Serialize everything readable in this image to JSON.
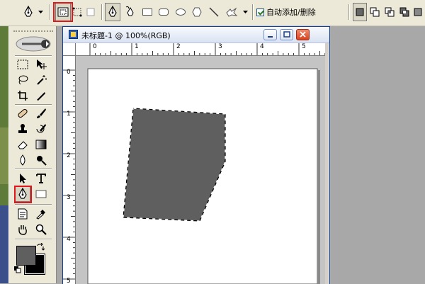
{
  "options_bar": {
    "auto_add_delete_label": "自动添加/删除",
    "auto_add_delete_checked": true,
    "icons": [
      "pen-tool-icon",
      "dropdown-arrow-icon",
      "shape-layers-icon",
      "paths-icon",
      "fill-pixels-icon",
      "pen-icon",
      "freeform-pen-icon",
      "rectangle-icon",
      "rounded-rectangle-icon",
      "ellipse-icon",
      "polygon-icon",
      "line-icon",
      "custom-shape-icon",
      "dropdown-arrow-icon",
      "add-to-area-icon",
      "subtract-icon",
      "intersect-icon",
      "exclude-icon"
    ],
    "highlight_color": "#e0161b"
  },
  "tools_palette": {
    "foreground_color": "#5f5f5f",
    "background_color": "#000000",
    "icons": [
      "marquee-icon",
      "move-icon",
      "lasso-icon",
      "magic-wand-icon",
      "crop-icon",
      "slice-icon",
      "healing-brush-icon",
      "brush-icon",
      "clone-stamp-icon",
      "history-brush-icon",
      "eraser-icon",
      "gradient-icon",
      "blur-icon",
      "dodge-icon",
      "path-selection-icon",
      "type-icon",
      "pen-tool-icon",
      "rectangle-icon",
      "notes-icon",
      "eyedropper-icon",
      "hand-icon",
      "zoom-icon"
    ]
  },
  "document": {
    "title": "未标题-1 @ 100%(RGB)",
    "ruler_x_labels": [
      "0",
      "1",
      "2",
      "3",
      "4",
      "5"
    ],
    "ruler_y_labels": [
      "0",
      "1",
      "2",
      "3",
      "4",
      "5"
    ],
    "canvas_color": "#ffffff",
    "shape_color": "#5f5f5f",
    "shape_description_selected": true
  }
}
